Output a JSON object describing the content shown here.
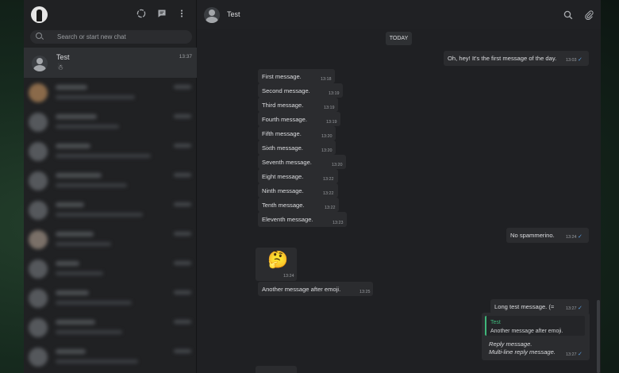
{
  "sidebar": {
    "search_placeholder": "Search or start new chat",
    "active_chat": {
      "name": "Test",
      "time": "13:37",
      "preview": "☃"
    }
  },
  "conversation": {
    "title": "Test",
    "day_label": "TODAY",
    "messages": [
      {
        "text": "Oh, hey! It's the first message of the day.",
        "time": "13:03",
        "dir": "out"
      },
      {
        "text": "First message.",
        "time": "13:18",
        "dir": "in"
      },
      {
        "text": "Second message.",
        "time": "13:19",
        "dir": "in"
      },
      {
        "text": "Third message.",
        "time": "13:19",
        "dir": "in"
      },
      {
        "text": "Fourth message.",
        "time": "13:19",
        "dir": "in"
      },
      {
        "text": "Fifth message.",
        "time": "13:20",
        "dir": "in"
      },
      {
        "text": "Sixth message.",
        "time": "13:20",
        "dir": "in"
      },
      {
        "text": "Seventh message.",
        "time": "13:20",
        "dir": "in"
      },
      {
        "text": "Eight message.",
        "time": "13:22",
        "dir": "in"
      },
      {
        "text": "Ninth message.",
        "time": "13:22",
        "dir": "in"
      },
      {
        "text": "Tenth message.",
        "time": "13:22",
        "dir": "in"
      },
      {
        "text": "Eleventh message.",
        "time": "13:23",
        "dir": "in"
      },
      {
        "text": "No spammerino.",
        "time": "13:24",
        "dir": "out"
      },
      {
        "text": "🤔",
        "time": "13:24",
        "dir": "in"
      },
      {
        "text": "Another message after emoji.",
        "time": "13:25",
        "dir": "in"
      },
      {
        "text": "Long test message. (=",
        "time": "13:27",
        "dir": "out"
      },
      {
        "reply_to_name": "Test",
        "reply_to_text": "Another message after emoji.",
        "line1": "Reply message.",
        "line2": "Multi-line reply message.",
        "time": "13:27",
        "dir": "out"
      }
    ]
  },
  "colors": {
    "app_bg": "#1e1f21",
    "bubble_bg": "#2b2c2f",
    "read_check": "#5aa0e6",
    "reply_accent": "#3fb67a"
  },
  "icons": {
    "sidebar_header": [
      "status-icon",
      "new-chat-icon",
      "menu-dots-icon"
    ],
    "conversation_header": [
      "search-icon",
      "attach-icon",
      "menu-dots-icon"
    ]
  }
}
